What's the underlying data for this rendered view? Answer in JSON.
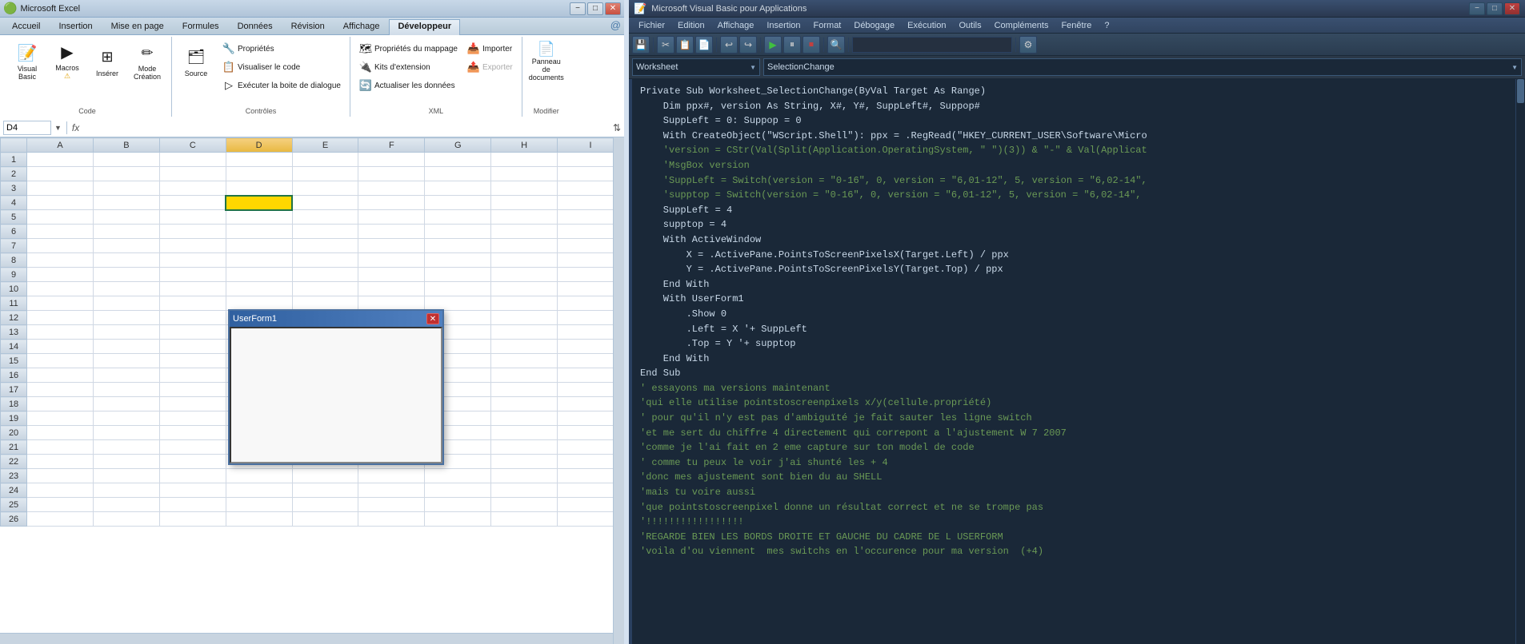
{
  "excel": {
    "titlebar": {
      "title": "Microsoft Excel",
      "icon": "📊",
      "controls": [
        "−",
        "□",
        "✕"
      ]
    },
    "tabs": [
      {
        "label": "Accueil",
        "active": false
      },
      {
        "label": "Insertion",
        "active": false
      },
      {
        "label": "Mise en page",
        "active": false
      },
      {
        "label": "Formules",
        "active": false
      },
      {
        "label": "Données",
        "active": false
      },
      {
        "label": "Révision",
        "active": false
      },
      {
        "label": "Affichage",
        "active": false
      },
      {
        "label": "Développeur",
        "active": true
      }
    ],
    "ribbon_groups": [
      {
        "label": "Code",
        "buttons_large": [
          {
            "label": "Visual\nBasic",
            "icon": "📝"
          },
          {
            "label": "Macros",
            "icon": "▶"
          },
          {
            "label": "Insérer",
            "icon": "⊞"
          },
          {
            "label": "Mode\nCréation",
            "icon": "✏️"
          }
        ],
        "warning": true
      },
      {
        "label": "Contrôles",
        "buttons_small": [
          {
            "label": "Propriétés",
            "icon": "🔧"
          },
          {
            "label": "Visualiser le code",
            "icon": "📋"
          },
          {
            "label": "Exécuter la boite de dialogue",
            "icon": "▷"
          }
        ],
        "buttons_large": [
          {
            "label": "Source",
            "icon": "🗂️"
          }
        ]
      },
      {
        "label": "XML",
        "buttons_small": [
          {
            "label": "Propriétés du mappage",
            "icon": "🗺"
          },
          {
            "label": "Kits d'extension",
            "icon": "🔌"
          },
          {
            "label": "Actualiser les données",
            "icon": "🔄"
          },
          {
            "label": "Importer",
            "icon": "📥"
          },
          {
            "label": "Exporter",
            "icon": "📤"
          }
        ]
      },
      {
        "label": "Modifier",
        "buttons_large": [
          {
            "label": "Panneau de\ndocuments",
            "icon": "📄"
          }
        ]
      }
    ],
    "formula_bar": {
      "cell_ref": "D4",
      "fx": "fx"
    },
    "columns": [
      "A",
      "B",
      "C",
      "D",
      "E",
      "F",
      "G",
      "H",
      "I"
    ],
    "selected_col": "D",
    "selected_row": 4,
    "rows": [
      1,
      2,
      3,
      4,
      5,
      6,
      7,
      8,
      9,
      10,
      11,
      12,
      13,
      14,
      15,
      16,
      17,
      18,
      19,
      20,
      21,
      22,
      23,
      24,
      25,
      26
    ],
    "userform": {
      "title": "UserForm1",
      "close_btn": "✕"
    }
  },
  "vba": {
    "titlebar": {
      "title": "Microsoft Visual Basic pour Applications",
      "icon": "📝",
      "controls": [
        "−",
        "□",
        "✕"
      ]
    },
    "menubar": [
      "Fichier",
      "Edition",
      "Affichage",
      "Insertion",
      "Format",
      "Débogage",
      "Exécution",
      "Outils",
      "Compléments",
      "Fenêtre",
      "?"
    ],
    "toolbar_buttons": [
      "💾",
      "✂",
      "📋",
      "📄",
      "↩",
      "↪",
      "▶",
      "⏸",
      "⏹",
      "🔍",
      "⚙"
    ],
    "dropdowns": {
      "left": "Worksheet",
      "right": "SelectionChange"
    },
    "code_lines": [
      {
        "type": "normal",
        "text": "Private Sub Worksheet_SelectionChange(ByVal Target As Range)"
      },
      {
        "type": "normal",
        "text": ""
      },
      {
        "type": "normal",
        "text": "    Dim ppx#, version As String, X#, Y#, SuppLeft#, Suppop#"
      },
      {
        "type": "normal",
        "text": "    SuppLeft = 0: Suppop = 0"
      },
      {
        "type": "normal",
        "text": "    With CreateObject(\"WScript.Shell\"): ppx = .RegRead(\"HKEY_CURRENT_USER\\Software\\Micro"
      },
      {
        "type": "comment",
        "text": "    'version = CStr(Val(Split(Application.OperatingSystem, \" \")(3)) & \"-\" & Val(Applicat"
      },
      {
        "type": "comment",
        "text": "    'MsgBox version"
      },
      {
        "type": "comment",
        "text": "    'SuppLeft = Switch(version = \"0-16\", 0, version = \"6,01-12\", 5, version = \"6,02-14\","
      },
      {
        "type": "comment",
        "text": "    'supptop = Switch(version = \"0-16\", 0, version = \"6,01-12\", 5, version = \"6,02-14\","
      },
      {
        "type": "normal",
        "text": "    SuppLeft = 4"
      },
      {
        "type": "normal",
        "text": "    supptop = 4"
      },
      {
        "type": "normal",
        "text": ""
      },
      {
        "type": "normal",
        "text": "    With ActiveWindow"
      },
      {
        "type": "normal",
        "text": "        X = .ActivePane.PointsToScreenPixelsX(Target.Left) / ppx"
      },
      {
        "type": "normal",
        "text": "        Y = .ActivePane.PointsToScreenPixelsY(Target.Top) / ppx"
      },
      {
        "type": "normal",
        "text": "    End With"
      },
      {
        "type": "normal",
        "text": "    With UserForm1"
      },
      {
        "type": "normal",
        "text": "        .Show 0"
      },
      {
        "type": "normal",
        "text": "        .Left = X '+ SuppLeft"
      },
      {
        "type": "normal",
        "text": "        .Top = Y '+ supptop"
      },
      {
        "type": "normal",
        "text": "    End With"
      },
      {
        "type": "normal",
        "text": "End Sub"
      },
      {
        "type": "normal",
        "text": ""
      },
      {
        "type": "comment",
        "text": "' essayons ma versions maintenant"
      },
      {
        "type": "comment",
        "text": "'qui elle utilise pointstoscreenpixels x/y(cellule.propriété)"
      },
      {
        "type": "comment",
        "text": "' pour qu'il n'y est pas d'ambiguïté je fait sauter les ligne switch"
      },
      {
        "type": "comment",
        "text": "'et me sert du chiffre 4 directement qui correpont a l'ajustement W 7 2007"
      },
      {
        "type": "comment",
        "text": "'comme je l'ai fait en 2 eme capture sur ton model de code"
      },
      {
        "type": "comment",
        "text": "' comme tu peux le voir j'ai shunté les + 4"
      },
      {
        "type": "comment",
        "text": "'donc mes ajustement sont bien du au SHELL"
      },
      {
        "type": "comment",
        "text": "'mais tu voire aussi"
      },
      {
        "type": "comment",
        "text": "'que pointstoscreenpixel donne un résultat correct et ne se trompe pas"
      },
      {
        "type": "comment",
        "text": "'!!!!!!!!!!!!!!!!!"
      },
      {
        "type": "comment",
        "text": "'REGARDE BIEN LES BORDS DROITE ET GAUCHE DU CADRE DE L USERFORM"
      },
      {
        "type": "comment",
        "text": "'voila d'ou viennent  mes switchs en l'occurence pour ma version  (+4)"
      }
    ]
  }
}
